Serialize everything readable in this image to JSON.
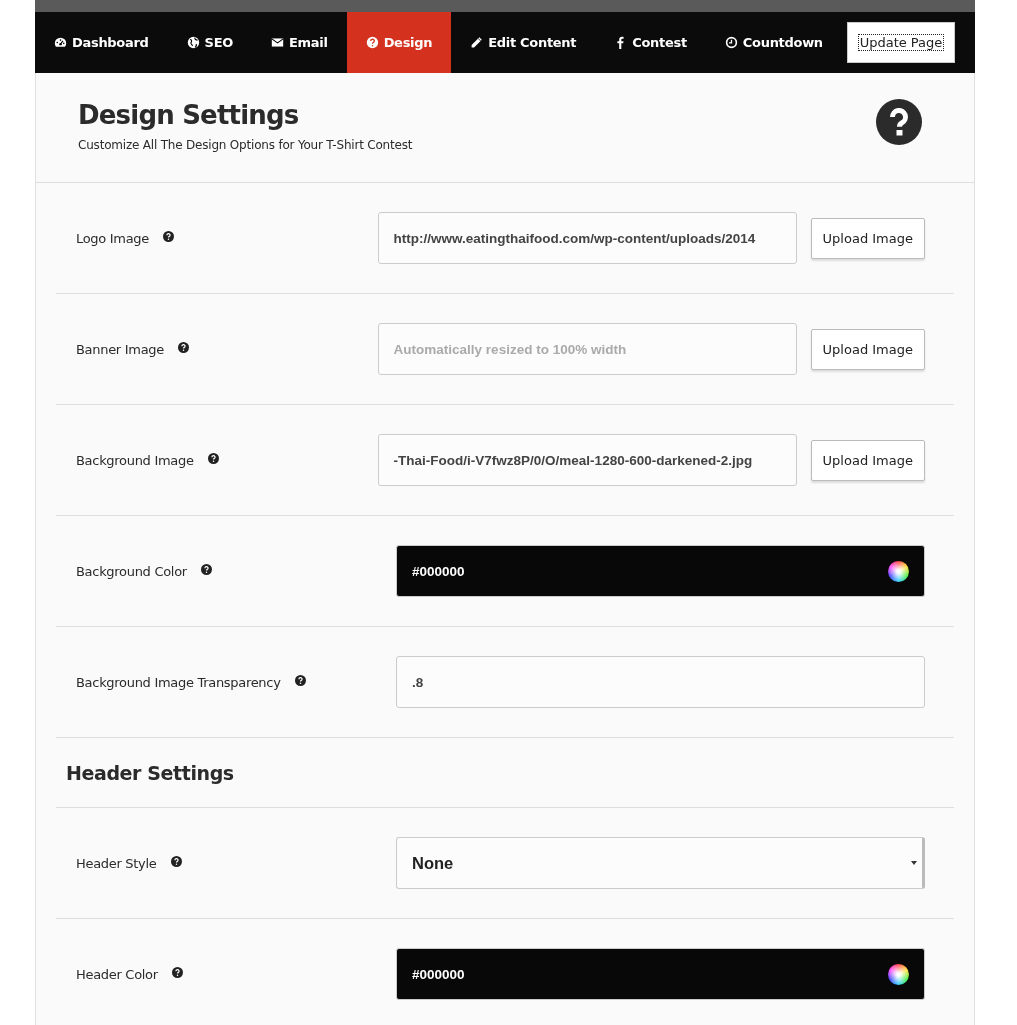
{
  "nav": {
    "items": [
      {
        "label": "Dashboard",
        "selected": false
      },
      {
        "label": "SEO",
        "selected": false
      },
      {
        "label": "Email",
        "selected": false
      },
      {
        "label": "Design",
        "selected": true
      },
      {
        "label": "Edit Content",
        "selected": false
      },
      {
        "label": "Contest",
        "selected": false
      },
      {
        "label": "Countdown",
        "selected": false
      }
    ],
    "button": "Update Page"
  },
  "header": {
    "title": "Design Settings",
    "subtitle": "Customize All The Design Options for Your T-Shirt Contest"
  },
  "rows": [
    {
      "kind": "image",
      "label": "Logo Image",
      "value": "http://www.eatingthaifood.com/wp-content/uploads/2014",
      "button": "Upload Image"
    },
    {
      "kind": "image",
      "label": "Banner Image",
      "placeholder": "Automatically resized to 100% width",
      "button": "Upload Image"
    },
    {
      "kind": "image",
      "label": "Background Image",
      "value": "-Thai-Food/i-V7fwz8P/0/O/meal-1280-600-darkened-2.jpg",
      "button": "Upload Image"
    },
    {
      "kind": "color",
      "label": "Background Color",
      "value": "#000000"
    },
    {
      "kind": "text",
      "label": "Background Image Transparency",
      "value": ".8"
    },
    {
      "kind": "section",
      "label": "Header Settings"
    },
    {
      "kind": "select",
      "label": "Header Style",
      "value": "None"
    },
    {
      "kind": "color",
      "label": "Header Color",
      "value": "#000000"
    }
  ]
}
